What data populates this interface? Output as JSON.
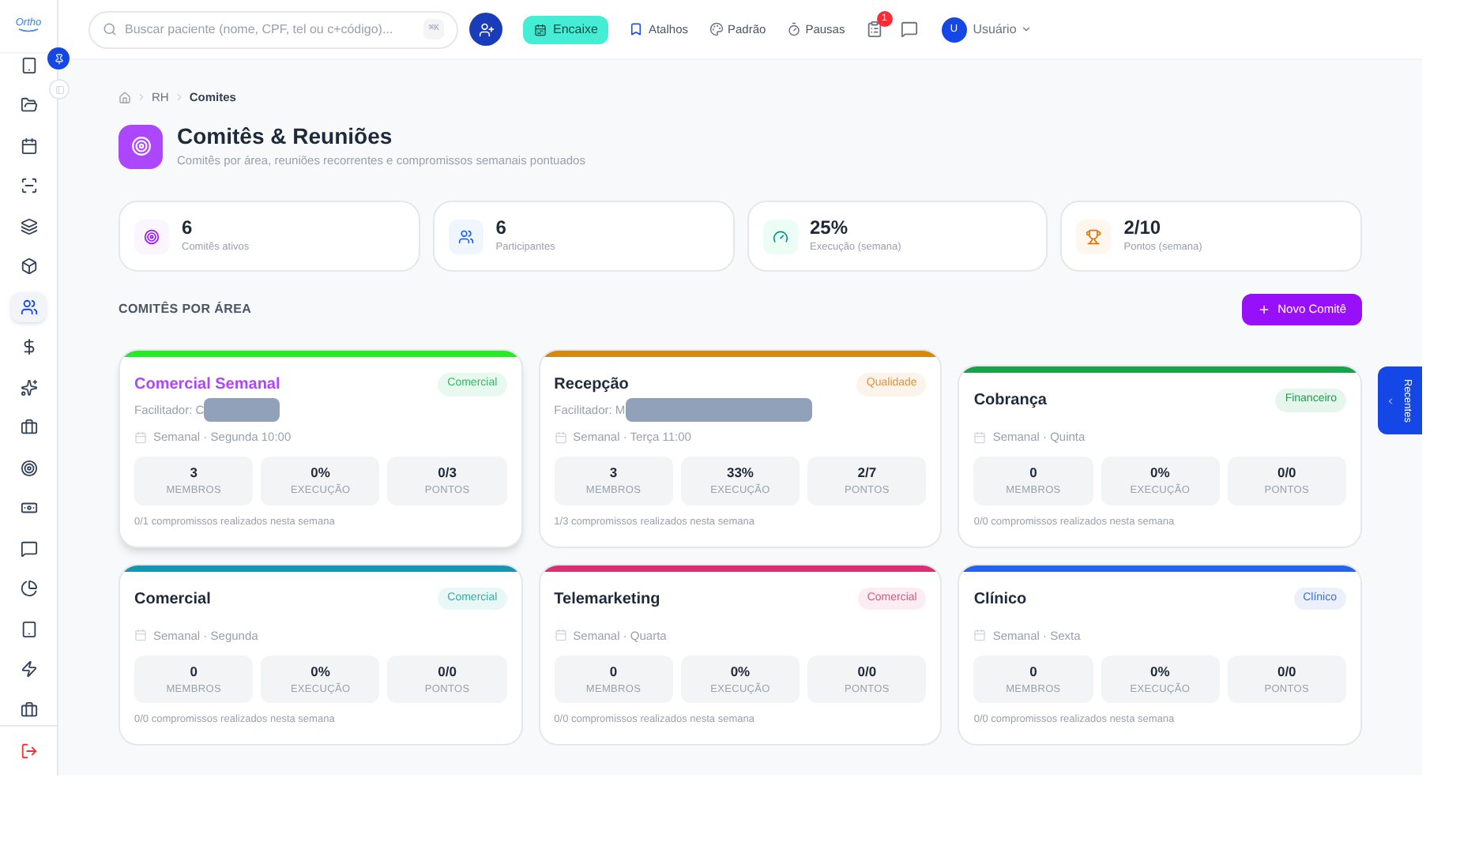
{
  "logo": "Ortho",
  "sidebar": {
    "items": [
      {
        "selected": false
      },
      {
        "selected": false
      },
      {
        "selected": false
      },
      {
        "selected": false
      },
      {
        "selected": false
      },
      {
        "selected": false
      },
      {
        "selected": true
      },
      {
        "selected": false
      },
      {
        "selected": false
      },
      {
        "selected": false
      },
      {
        "selected": false
      },
      {
        "selected": false
      },
      {
        "selected": false
      },
      {
        "selected": false
      },
      {
        "selected": false
      },
      {
        "selected": false
      },
      {
        "selected": false
      }
    ]
  },
  "topbar": {
    "search": {
      "placeholder": "Buscar paciente (nome, CPF, tel ou c+código)...",
      "shortcut": "⌘K"
    },
    "encaixe": "Encaixe",
    "links": [
      "Atalhos",
      "Padrão",
      "Pausas"
    ],
    "notifications": "1",
    "avatar": "U",
    "user": "Usuário"
  },
  "breadcrumb": [
    "RH",
    "Comites"
  ],
  "header": {
    "title": "Comitês & Reuniões",
    "subtitle": "Comitês por área, reuniões recorrentes e compromissos semanais pontuados"
  },
  "stats": [
    {
      "kind": "target",
      "value": "6",
      "label": "Comitês ativos"
    },
    {
      "kind": "users",
      "value": "6",
      "label": "Participantes"
    },
    {
      "kind": "gauge",
      "value": "25%",
      "label": "Execução (semana)"
    },
    {
      "kind": "trophy",
      "value": "2/10",
      "label": "Pontos (semana)"
    }
  ],
  "section_title": "COMITÊS POR ÁREA",
  "new_button": "Novo Comitê",
  "committees": [
    {
      "title": "Comercial Semanal",
      "highlighted": true,
      "color": "#22ee22",
      "tag": {
        "label": "Comercial",
        "color": "#22c55e"
      },
      "facilitator": "Facilitador: C",
      "schedule": "Semanal · Segunda 10:00",
      "metrics": [
        {
          "value": "3",
          "label": "MEMBROS"
        },
        {
          "value": "0%",
          "label": "EXECUÇÃO"
        },
        {
          "value": "0/3",
          "label": "PONTOS"
        }
      ],
      "footer": "0/1 compromissos realizados nesta semana"
    },
    {
      "title": "Recepção",
      "highlighted": false,
      "color": "#d4890f",
      "tag": {
        "label": "Qualidade",
        "color": "#e0913a"
      },
      "facilitator": "Facilitador: M",
      "schedule": "Semanal · Terça 11:00",
      "metrics": [
        {
          "value": "3",
          "label": "MEMBROS"
        },
        {
          "value": "33%",
          "label": "EXECUÇÃO"
        },
        {
          "value": "2/7",
          "label": "PONTOS"
        }
      ],
      "footer": "1/3 compromissos realizados nesta semana"
    },
    {
      "title": "Cobrança",
      "highlighted": false,
      "color": "#16a34a",
      "tag": {
        "label": "Financeiro",
        "color": "#16a34a"
      },
      "schedule": "Semanal · Quinta",
      "metrics": [
        {
          "value": "0",
          "label": "MEMBROS"
        },
        {
          "value": "0%",
          "label": "EXECUÇÃO"
        },
        {
          "value": "0/0",
          "label": "PONTOS"
        }
      ],
      "footer": "0/0 compromissos realizados nesta semana"
    },
    {
      "title": "Comercial",
      "highlighted": false,
      "color": "#1596b3",
      "tag": {
        "label": "Comercial",
        "color": "#2bb3a8"
      },
      "schedule": "Semanal · Segunda",
      "metrics": [
        {
          "value": "0",
          "label": "MEMBROS"
        },
        {
          "value": "0%",
          "label": "EXECUÇÃO"
        },
        {
          "value": "0/0",
          "label": "PONTOS"
        }
      ],
      "footer": "0/0 compromissos realizados nesta semana"
    },
    {
      "title": "Telemarketing",
      "highlighted": false,
      "color": "#db2f74",
      "tag": {
        "label": "Comercial",
        "color": "#e0527f"
      },
      "schedule": "Semanal · Quarta",
      "metrics": [
        {
          "value": "0",
          "label": "MEMBROS"
        },
        {
          "value": "0%",
          "label": "EXECUÇÃO"
        },
        {
          "value": "0/0",
          "label": "PONTOS"
        }
      ],
      "footer": "0/0 compromissos realizados nesta semana"
    },
    {
      "title": "Clínico",
      "highlighted": false,
      "color": "#2563eb",
      "tag": {
        "label": "Clínico",
        "color": "#3b6fd8"
      },
      "schedule": "Semanal · Sexta",
      "metrics": [
        {
          "value": "0",
          "label": "MEMBROS"
        },
        {
          "value": "0%",
          "label": "EXECUÇÃO"
        },
        {
          "value": "0/0",
          "label": "PONTOS"
        }
      ],
      "footer": "0/0 compromissos realizados nesta semana"
    }
  ],
  "recent_tab": "Recentes"
}
